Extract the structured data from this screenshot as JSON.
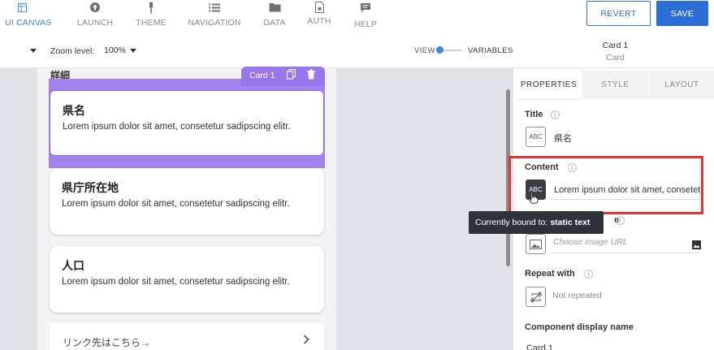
{
  "nav": {
    "items": [
      {
        "label": "UI CANVAS",
        "icon": "ui-canvas-icon"
      },
      {
        "label": "LAUNCH",
        "icon": "launch-icon"
      },
      {
        "label": "THEME",
        "icon": "theme-icon"
      },
      {
        "label": "NAVIGATION",
        "icon": "navigation-icon"
      },
      {
        "label": "DATA",
        "icon": "data-icon"
      },
      {
        "label": "AUTH",
        "icon": "auth-icon"
      },
      {
        "label": "HELP",
        "icon": "help-icon"
      }
    ],
    "active": "UI CANVAS"
  },
  "actions": {
    "revert_label": "REVERT",
    "save_label": "SAVE"
  },
  "toolbar": {
    "zoom_label": "Zoom level:",
    "zoom_value": "100%",
    "view_label": "VIEW",
    "variables_label": "VARIABLES"
  },
  "selection": {
    "title": "Card 1",
    "subtitle": "Card"
  },
  "canvas": {
    "section_title": "詳細",
    "badge_label": "Card 1",
    "cards": [
      {
        "title": "県名",
        "body": "Lorem ipsum dolor sit amet, consetetur sadipscing elitr."
      },
      {
        "title": "県庁所在地",
        "body": "Lorem ipsum dolor sit amet, consetetur sadipscing elitr."
      },
      {
        "title": "人口",
        "body": "Lorem ipsum dolor sit amet, consetetur sadipscing elitr."
      }
    ],
    "link_text": "リンク先はこちら→",
    "link_chevron": "›"
  },
  "panel": {
    "tabs": [
      {
        "label": "PROPERTIES",
        "active": true
      },
      {
        "label": "STYLE",
        "active": false
      },
      {
        "label": "LAYOUT",
        "active": false
      }
    ],
    "title_label": "Title",
    "title_value": "県名",
    "content_label": "Content",
    "content_value": "Lorem ipsum dolor sit amet, consetetur sadipscing elitr.",
    "image_label_tail": "e",
    "image_placeholder": "Choose image URL",
    "repeat_label": "Repeat with",
    "repeat_value": "Not repeated",
    "display_name_label": "Component display name",
    "display_name_value": "Card 1",
    "abc_glyph": "ABC"
  },
  "tooltip": {
    "prefix": "Currently bound to:",
    "value": "static text"
  },
  "colors": {
    "accent": "#2b6fd6",
    "selection": "#9a76ec",
    "highlight": "#e03532",
    "tooltip_bg": "#2f3238"
  }
}
